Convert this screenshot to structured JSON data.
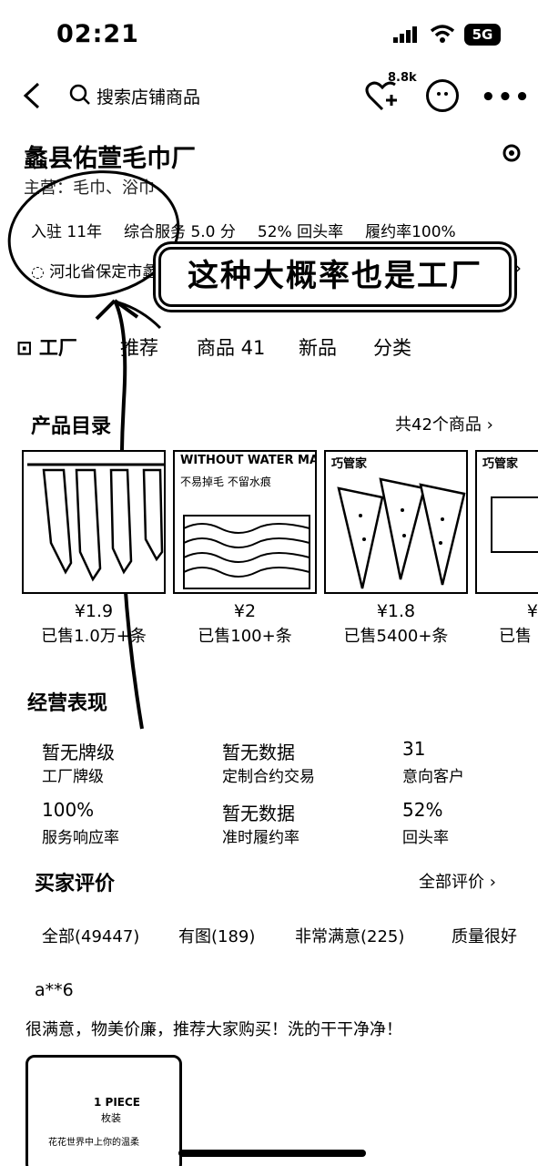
{
  "status": {
    "time": "02:21",
    "network": "5G"
  },
  "header": {
    "search_placeholder": "搜索店铺商品",
    "follow_count": "8.8k"
  },
  "shop": {
    "name": "蠡县佑萱毛巾厂",
    "category": "主营：毛巾、浴巾",
    "stats": [
      "入驻 11年",
      "综合服务 5.0 分",
      "52% 回头率",
      "履约率100%"
    ],
    "address": "河北省保定市蠡"
  },
  "annotation": {
    "banner_text": "这种大概率也是工厂"
  },
  "tabs": [
    "工厂",
    "推荐",
    "商品 41",
    "新品",
    "分类"
  ],
  "catalog": {
    "title": "产品目录",
    "count_link": "共42个商品",
    "products": [
      {
        "price": "¥1.9",
        "sold": "已售1.0万+条",
        "label": ""
      },
      {
        "price": "¥2",
        "sold": "已售100+条",
        "label": "WITHOUT WATER MARK",
        "sub": "不易掉毛 不留水痕"
      },
      {
        "price": "¥1.8",
        "sold": "已售5400+条",
        "label": "巧管家"
      },
      {
        "price": "¥",
        "sold": "已售",
        "label": "巧管家"
      }
    ]
  },
  "performance": {
    "title": "经营表现",
    "metrics": [
      {
        "value": "暂无牌级",
        "label": "工厂牌级"
      },
      {
        "value": "暂无数据",
        "label": "定制合约交易"
      },
      {
        "value": "31",
        "label": "意向客户"
      },
      {
        "value": "100%",
        "label": "服务响应率"
      },
      {
        "value": "暂无数据",
        "label": "准时履约率"
      },
      {
        "value": "52%",
        "label": "回头率"
      }
    ]
  },
  "reviews": {
    "title": "买家评价",
    "all_link": "全部评价",
    "chips": [
      "全部(49447)",
      "有图(189)",
      "非常满意(225)",
      "质量很好"
    ],
    "first": {
      "user": "a**6",
      "text": "很满意，物美价廉，推荐大家购买！洗的干干净净！",
      "image_title": "1 PIECE",
      "image_sub": "枚装",
      "image_caption": "花花世界中上你的温柔"
    }
  }
}
